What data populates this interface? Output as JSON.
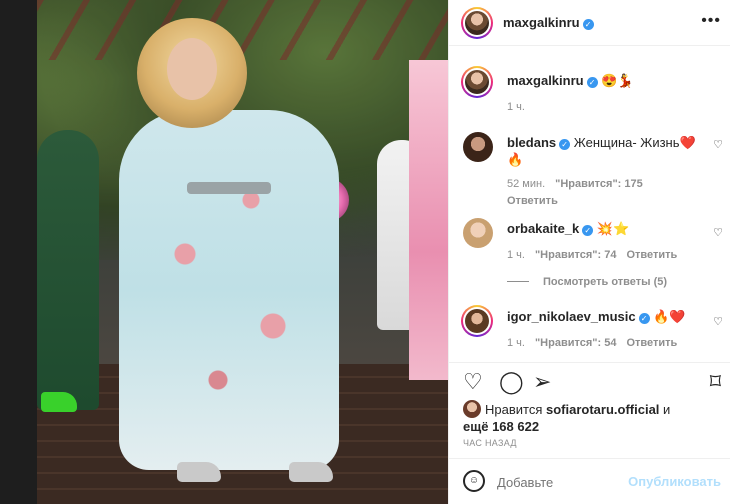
{
  "post_header": {
    "username": "maxgalkinru"
  },
  "caption": {
    "username": "maxgalkinru",
    "emojis": "😍💃",
    "time": "1 ч."
  },
  "comments": [
    {
      "username": "bledans",
      "text": "Женщина- Жизнь❤️🔥",
      "time": "52 мин.",
      "likes": "\"Нравится\": 175",
      "reply": "Ответить"
    },
    {
      "username": "orbakaite_k",
      "text": "💥⭐",
      "time": "1 ч.",
      "likes": "\"Нравится\": 74",
      "reply": "Ответить"
    },
    {
      "username": "igor_nikolaev_music",
      "text": "🔥❤️",
      "time": "1 ч.",
      "likes": "\"Нравится\": 54",
      "reply": "Ответить"
    }
  ],
  "view_replies": "Посмотреть ответы (5)",
  "likes": {
    "prefix": "Нравится",
    "user": "sofiarotaru.official",
    "and": "и",
    "more_prefix": "ещё",
    "count": "168 622"
  },
  "time_ago": "ЧАС НАЗАД",
  "composer": {
    "placeholder": "Добавьте",
    "post_label": "Опубликовать"
  },
  "icons": {
    "verified": "✓",
    "more": "•••",
    "heart": "♡",
    "comment": "◯",
    "share": "➢",
    "bookmark": "⌑",
    "emoji": "☺"
  },
  "colors": {
    "verified_blue": "#3897f0",
    "post_disabled": "#b2dffc"
  }
}
